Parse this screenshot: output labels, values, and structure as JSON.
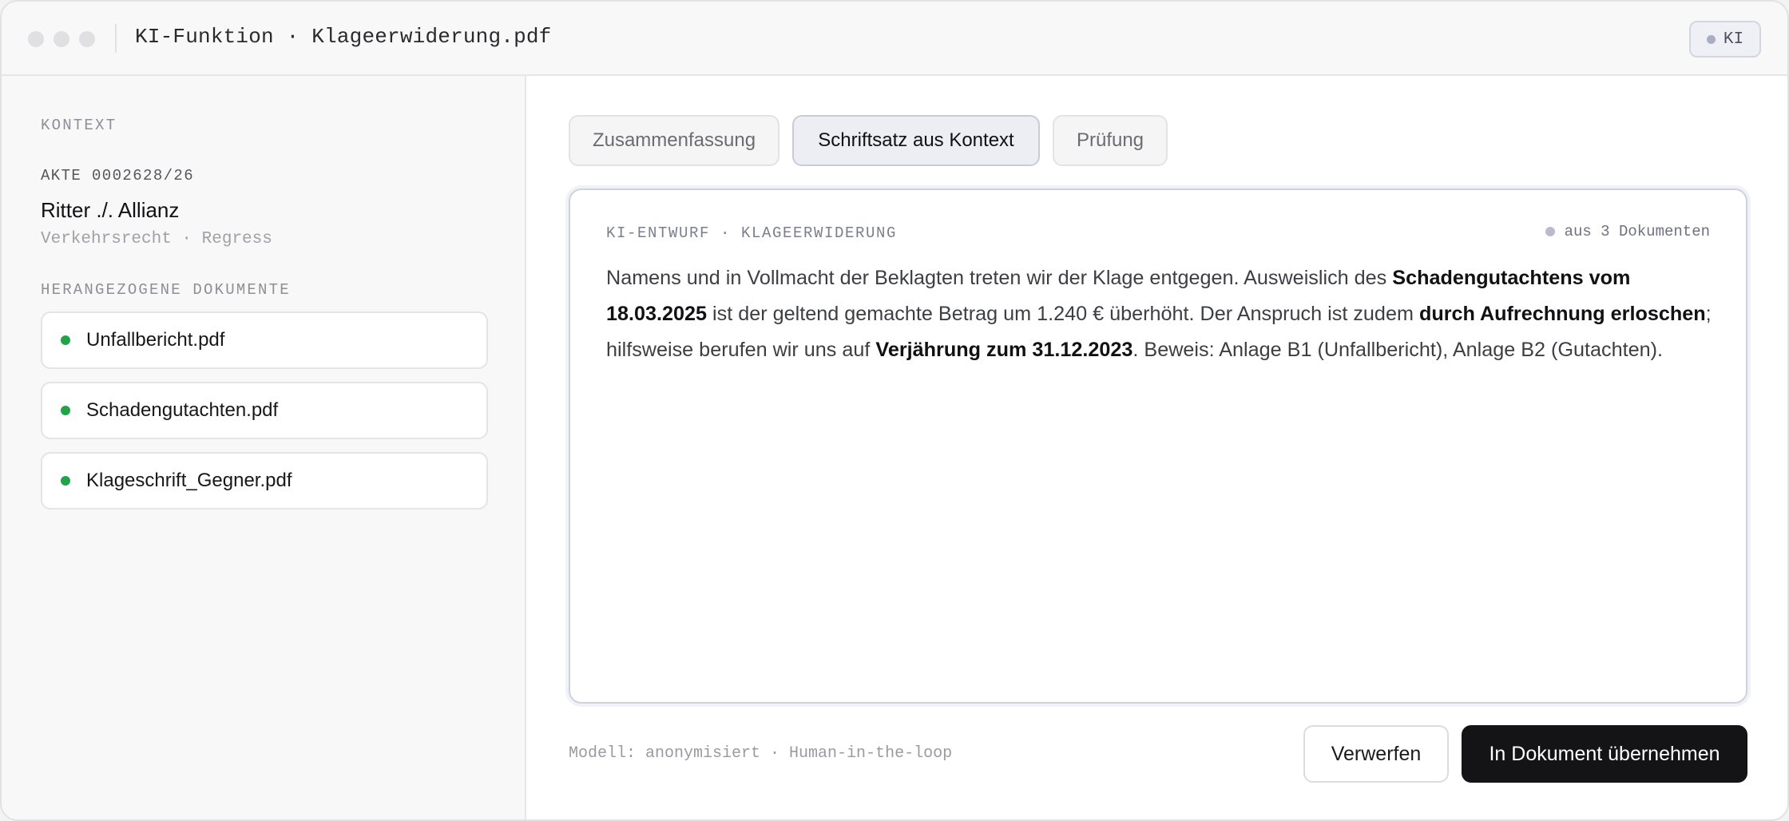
{
  "window": {
    "title": "KI-Funktion · Klageerwiderung.pdf",
    "badge": "KI"
  },
  "sidebar": {
    "section_label": "KONTEXT",
    "case_id": "AKTE 0002628/26",
    "case_title": "Ritter ./. Allianz",
    "case_subtitle": "Verkehrsrecht · Regress",
    "documents_label": "HERANGEZOGENE DOKUMENTE",
    "documents": [
      {
        "name": "Unfallbericht.pdf",
        "status_color": "#22a347"
      },
      {
        "name": "Schadengutachten.pdf",
        "status_color": "#22a347"
      },
      {
        "name": "Klageschrift_Gegner.pdf",
        "status_color": "#22a347"
      }
    ]
  },
  "main": {
    "tabs": [
      {
        "label": "Zusammenfassung",
        "active": false
      },
      {
        "label": "Schriftsatz aus Kontext",
        "active": true
      },
      {
        "label": "Prüfung",
        "active": false
      }
    ],
    "editor": {
      "header": "KI-ENTWURF · KLAGEERWIDERUNG",
      "source_note": "aus 3 Dokumenten",
      "text_segments": [
        {
          "text": "Namens und in Vollmacht der Beklagten treten wir der Klage entgegen. Ausweislich des ",
          "bold": false
        },
        {
          "text": "Schadengutachtens vom 18.03.2025",
          "bold": true
        },
        {
          "text": " ist der geltend gemachte Betrag um 1.240 € überhöht. Der Anspruch ist zudem ",
          "bold": false
        },
        {
          "text": "durch Aufrechnung erloschen",
          "bold": true
        },
        {
          "text": "; hilfsweise berufen wir uns auf ",
          "bold": false
        },
        {
          "text": "Verjährung zum 31.12.2023",
          "bold": true
        },
        {
          "text": ". Beweis: Anlage B1 (Unfallbericht), Anlage B2 (Gutachten).",
          "bold": false
        }
      ]
    },
    "footer_note": "Modell: anonymisiert · Human-in-the-loop",
    "discard_label": "Verwerfen",
    "apply_label": "In Dokument übernehmen"
  },
  "colors": {
    "accent_dark": "#141416",
    "status_green": "#22a347",
    "active_tab_bg": "#eceef3"
  }
}
